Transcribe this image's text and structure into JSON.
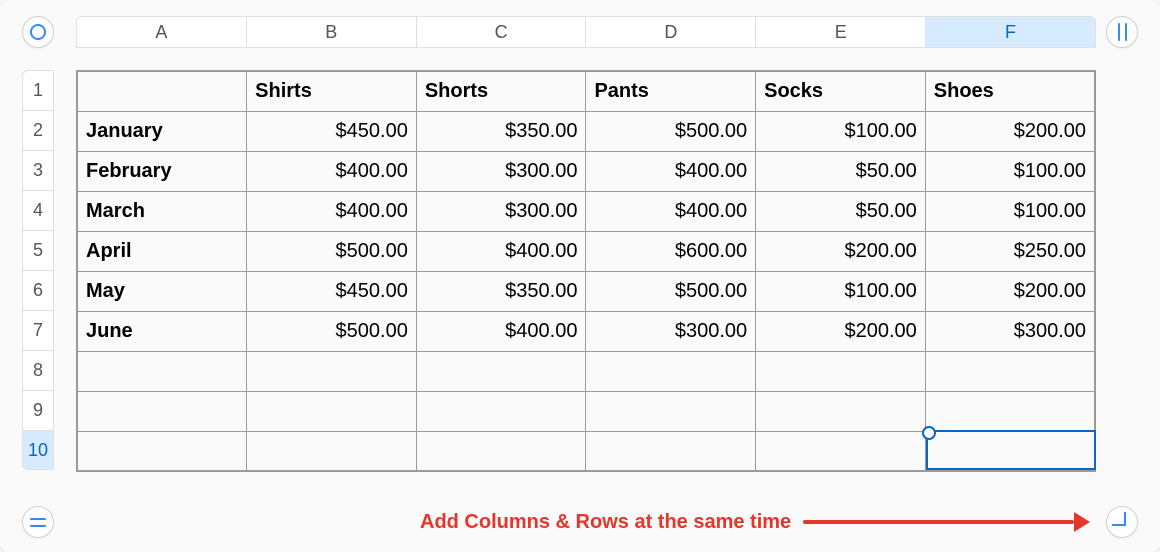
{
  "columns": [
    "A",
    "B",
    "C",
    "D",
    "E",
    "F"
  ],
  "selected_column_index": 5,
  "rows": [
    "1",
    "2",
    "3",
    "4",
    "5",
    "6",
    "7",
    "8",
    "9",
    "10"
  ],
  "selected_row_index": 9,
  "header_row": [
    "",
    "Shirts",
    "Shorts",
    "Pants",
    "Socks",
    "Shoes"
  ],
  "data_rows": [
    {
      "label": "January",
      "values": [
        "$450.00",
        "$350.00",
        "$500.00",
        "$100.00",
        "$200.00"
      ]
    },
    {
      "label": "February",
      "values": [
        "$400.00",
        "$300.00",
        "$400.00",
        "$50.00",
        "$100.00"
      ]
    },
    {
      "label": "March",
      "values": [
        "$400.00",
        "$300.00",
        "$400.00",
        "$50.00",
        "$100.00"
      ]
    },
    {
      "label": "April",
      "values": [
        "$500.00",
        "$400.00",
        "$600.00",
        "$200.00",
        "$250.00"
      ]
    },
    {
      "label": "May",
      "values": [
        "$450.00",
        "$350.00",
        "$500.00",
        "$100.00",
        "$200.00"
      ]
    },
    {
      "label": "June",
      "values": [
        "$500.00",
        "$400.00",
        "$300.00",
        "$200.00",
        "$300.00"
      ]
    }
  ],
  "empty_rows": 3,
  "active_cell": {
    "row": 10,
    "col": "F"
  },
  "annotation": "Add Columns & Rows at the same time"
}
